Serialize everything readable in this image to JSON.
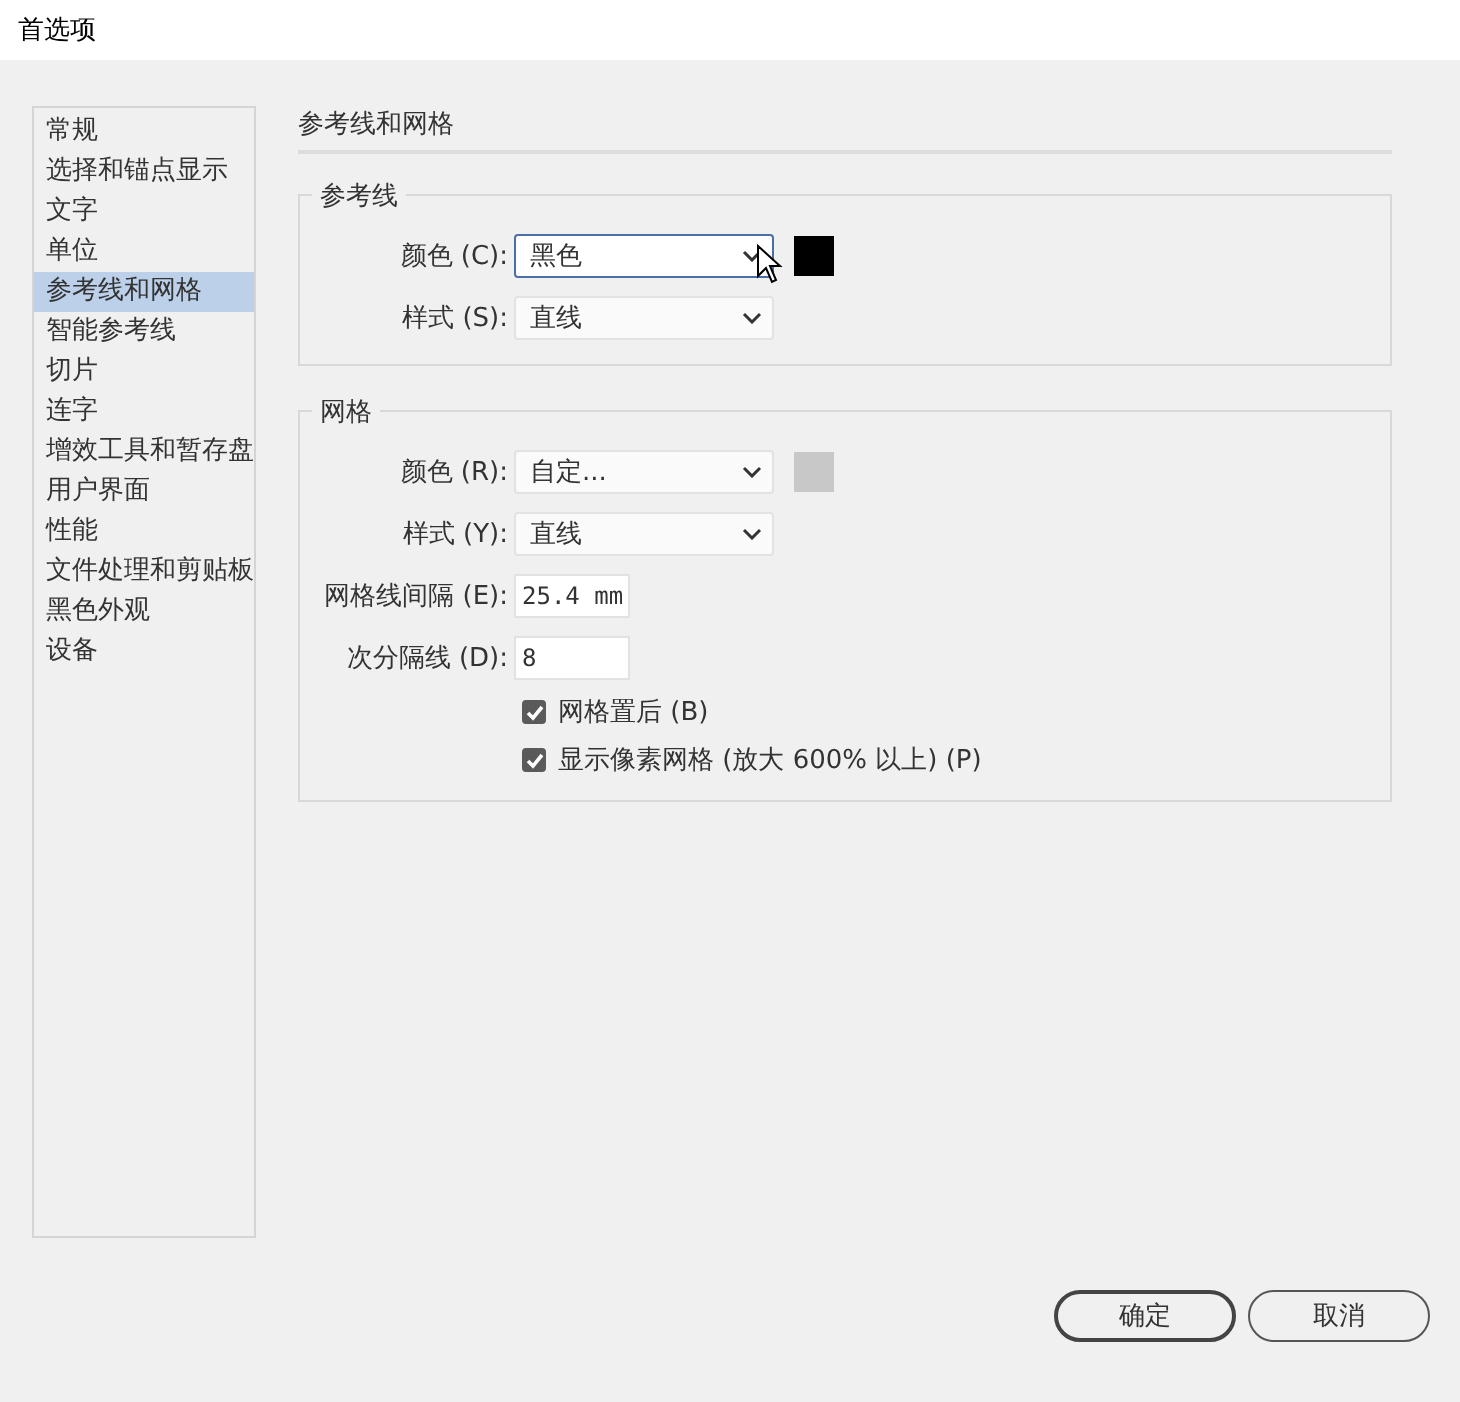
{
  "window": {
    "title": "首选项"
  },
  "sidebar": {
    "items": [
      {
        "label": "常规",
        "selected": false
      },
      {
        "label": "选择和锚点显示",
        "selected": false
      },
      {
        "label": "文字",
        "selected": false
      },
      {
        "label": "单位",
        "selected": false
      },
      {
        "label": "参考线和网格",
        "selected": true
      },
      {
        "label": "智能参考线",
        "selected": false
      },
      {
        "label": "切片",
        "selected": false
      },
      {
        "label": "连字",
        "selected": false
      },
      {
        "label": "增效工具和暂存盘",
        "selected": false
      },
      {
        "label": "用户界面",
        "selected": false
      },
      {
        "label": "性能",
        "selected": false
      },
      {
        "label": "文件处理和剪贴板",
        "selected": false
      },
      {
        "label": "黑色外观",
        "selected": false
      },
      {
        "label": "设备",
        "selected": false
      }
    ]
  },
  "section": {
    "title": "参考线和网格"
  },
  "groups": [
    {
      "title": "参考线",
      "rows": [
        {
          "kind": "select",
          "label": "颜色 (C):",
          "value": "黑色",
          "focused": true,
          "color": "#000000"
        },
        {
          "kind": "select",
          "label": "样式 (S):",
          "value": "直线",
          "focused": false
        }
      ]
    },
    {
      "title": "网格",
      "rows": [
        {
          "kind": "select",
          "label": "颜色 (R):",
          "value": "自定...",
          "focused": false,
          "color": "#c8c8c8"
        },
        {
          "kind": "select",
          "label": "样式 (Y):",
          "value": "直线",
          "focused": false
        },
        {
          "kind": "input",
          "label": "网格线间隔 (E):",
          "value": "25.4 mm"
        },
        {
          "kind": "input",
          "label": "次分隔线 (D):",
          "value": "8"
        },
        {
          "kind": "checkbox",
          "label": "网格置后 (B)",
          "checked": true
        },
        {
          "kind": "checkbox",
          "label": "显示像素网格 (放大 600% 以上) (P)",
          "checked": true
        }
      ]
    }
  ],
  "buttons": [
    {
      "label": "确定",
      "default": true
    },
    {
      "label": "取消",
      "default": false
    }
  ]
}
